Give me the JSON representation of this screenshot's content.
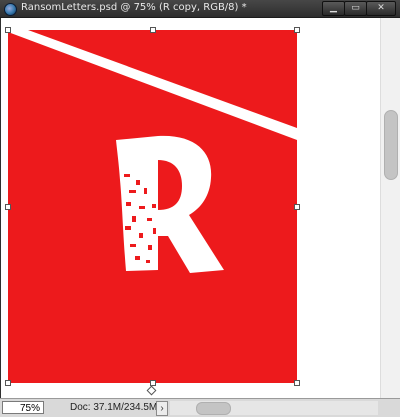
{
  "window": {
    "title": "RansomLetters.psd @ 75% (R copy, RGB/8) *",
    "buttons": {
      "minimize": "▁",
      "maximize": "▭",
      "close": "✕"
    }
  },
  "document": {
    "letter": "R",
    "background_color": "#ed1a1c",
    "foreground_color": "#ffffff"
  },
  "statusbar": {
    "zoom": "75%",
    "doc_info": "Doc: 37.1M/234.5M",
    "arrow": "›"
  },
  "icons": {
    "app": "photoshop-icon",
    "vertical_scroll": "scroll-thumb",
    "horizontal_scroll": "scroll-thumb"
  }
}
